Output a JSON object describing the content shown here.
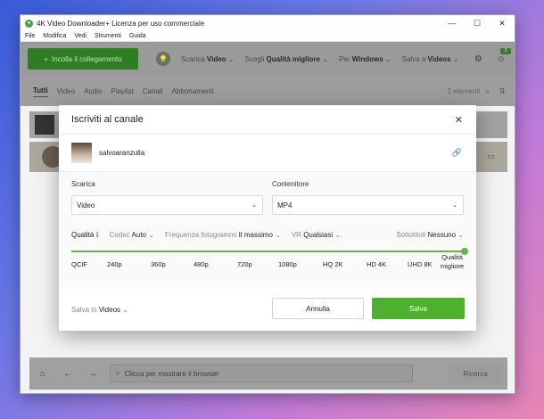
{
  "window": {
    "title": "4K Video Downloader+ Licenza per uso commerciale",
    "controls": {
      "minimize": "—",
      "maximize": "☐",
      "close": "✕"
    }
  },
  "menu": [
    "File",
    "Modifica",
    "Vedi",
    "Strumenti",
    "Guida"
  ],
  "toolbar": {
    "paste_label": "Incolla il collegamento",
    "download_prefix": "Scarica",
    "download_value": "Video",
    "choose_prefix": "Scegli",
    "choose_value": "Qualità migliore",
    "for_prefix": "Per",
    "for_value": "Windows",
    "save_prefix": "Salva a",
    "save_value": "Videos",
    "notif_count": "3"
  },
  "tabs": {
    "items": [
      "Tutti",
      "Video",
      "Audio",
      "Playlist",
      "Canali",
      "Abbonamenti"
    ],
    "active": "Tutti",
    "count": "2 elementi"
  },
  "bottom": {
    "browser_placeholder": "Clicca per mostrare il browser",
    "search_label": "Ricerca"
  },
  "modal": {
    "title": "Iscriviti al canale",
    "channel_name": "salvoaranzulla",
    "download_label": "Scarica",
    "download_value": "Video",
    "container_label": "Contenitore",
    "container_value": "MP4",
    "quality_label": "Qualità",
    "quality_info": "ℹ",
    "codec_label": "Codec",
    "codec_value": "Auto",
    "fps_label": "Frequenza fotogrammi",
    "fps_value": "Il massimo",
    "vr_label": "VR",
    "vr_value": "Qualsiasi",
    "subs_label": "Sottotitoli",
    "subs_value": "Nessuno",
    "slider_selected": "Qualità migliore",
    "slider_ticks": [
      "QCIF",
      "240p",
      "360p",
      "480p",
      "720p",
      "1080p",
      "HQ 2K",
      "HD 4K",
      "UHD 8K",
      "Qualità migliore"
    ],
    "save_in_label": "Salva in",
    "save_in_value": "Videos",
    "cancel_label": "Annulla",
    "save_label": "Salva"
  },
  "colors": {
    "accent": "#4db12f",
    "toolbar_overlay": "#9a9a9a"
  }
}
